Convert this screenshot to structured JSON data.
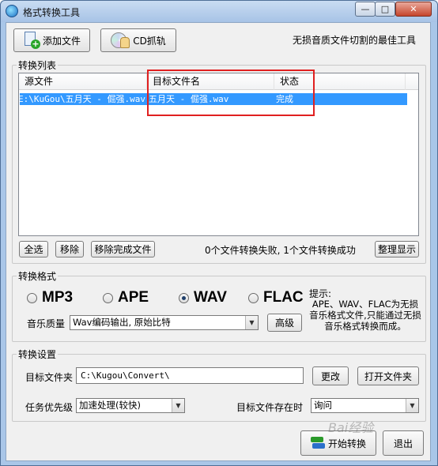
{
  "window": {
    "title": "格式转换工具",
    "minimize": "—",
    "maximize": "□",
    "close": "✕"
  },
  "toolbar": {
    "add_file": "添加文件",
    "cd_rip": "CD抓轨",
    "slogan": "无损音质文件切割的最佳工具"
  },
  "conversion_list": {
    "group_label": "转换列表",
    "columns": [
      "源文件",
      "目标文件名",
      "状态"
    ],
    "rows": [
      {
        "source": "E:\\KuGou\\五月天 - 倔强.wav",
        "target": "五月天 - 倔强.wav",
        "status": "完成"
      }
    ],
    "buttons": {
      "select_all": "全选",
      "remove": "移除",
      "remove_done": "移除完成文件",
      "tidy": "整理显示"
    },
    "summary": "0个文件转换失败, 1个文件转换成功"
  },
  "format": {
    "group_label": "转换格式",
    "options": [
      "MP3",
      "APE",
      "WAV",
      "FLAC"
    ],
    "selected": "WAV",
    "quality_label": "音乐质量",
    "quality_value": "Wav编码输出, 原始比特",
    "advanced": "高级",
    "hint_title": "提示:",
    "hint_text": "APE、WAV、FLAC为无损音乐格式文件,只能通过无损音乐格式转换而成。"
  },
  "settings": {
    "group_label": "转换设置",
    "target_folder_label": "目标文件夹",
    "target_folder_value": "C:\\Kugou\\Convert\\",
    "change": "更改",
    "open_folder": "打开文件夹",
    "priority_label": "任务优先级",
    "priority_value": "加速处理(较快)",
    "exists_label": "目标文件存在时",
    "exists_value": "询问"
  },
  "actions": {
    "start": "开始转换",
    "exit": "退出"
  },
  "watermark": "Bai经验",
  "icons": [
    "app-icon",
    "add-file-icon",
    "cd-icon",
    "start-convert-icon",
    "chevron-down-icon"
  ]
}
